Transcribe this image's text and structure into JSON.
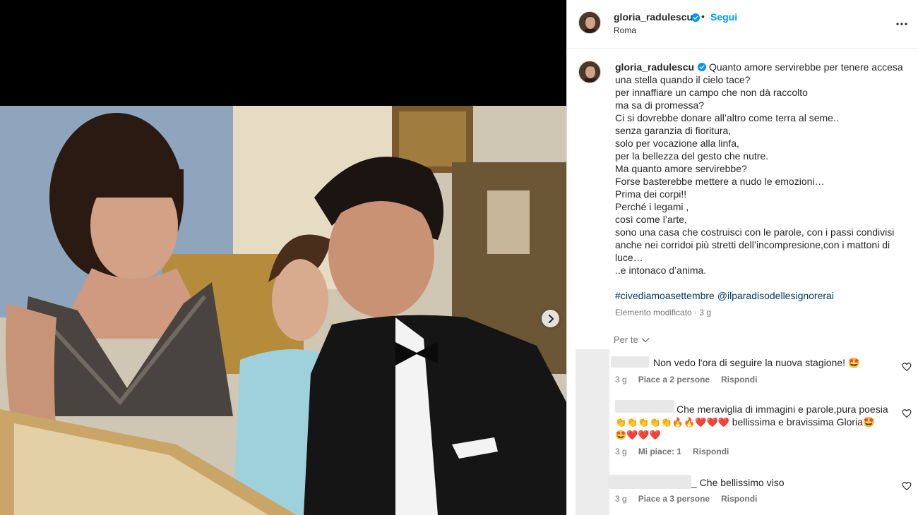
{
  "post": {
    "username": "gloria_radulescu",
    "follow_label": "Segui",
    "separator": "•",
    "location": "Roma"
  },
  "caption": {
    "username": "gloria_radulescu",
    "lines": [
      "Quanto amore servirebbe per tenere accesa",
      "una stella quando il cielo tace?",
      "per innaffiare un campo che non dà raccolto",
      "ma sa di promessa?",
      "Ci si dovrebbe donare all’altro come terra al seme..",
      "senza garanzia di fioritura,",
      "solo per vocazione alla linfa,",
      "per la bellezza del gesto che nutre.",
      "Ma quanto amore servirebbe?",
      "Forse basterebbe mettere a nudo le emozioni…",
      "Prima dei corpi!!",
      "Perché i legami ,",
      "così come l’arte,",
      "sono una casa che costruisci con le parole, con i passi condivisi",
      "anche nei corridoi più stretti dell’incompresione,con i mattoni di",
      "luce…",
      "..e intonaco d’anima."
    ],
    "hashtag_1": "#civediamoasettembre",
    "hashtag_2": "@ilparadisodellesignorerai",
    "edited": "Elemento modificato · 3 g"
  },
  "sort_label": "Per te",
  "comments": [
    {
      "text": "Non vedo l'ora di seguire la nuova stagione! 🤩",
      "time": "3 g",
      "likes": "Piace a 2 persone",
      "reply": "Rispondi"
    },
    {
      "text_line1": "Che meraviglia di immagini e parole,pura poesia",
      "emoji_line2": "👏👏👏👏👏🔥🔥❤️❤️❤️",
      "text_line2": " bellissima e bravissima Gloria🤩",
      "emoji_line3": "🤩❤️❤️❤️",
      "time": "3 g",
      "likes": "Mi piace: 1",
      "reply": "Rispondi"
    },
    {
      "text": "_ Che bellissimo viso",
      "time": "3 g",
      "likes": "Piace a 3 persone",
      "reply": "Rispondi"
    }
  ],
  "colors": {
    "link_blue": "#0095f6",
    "hashtag": "#00376b",
    "muted": "#737373",
    "verified": "#0095f6"
  },
  "icons": {
    "next": "chevron-right-icon",
    "more": "more-options-icon",
    "verified": "verified-badge-icon",
    "like": "heart-icon",
    "sort": "chevron-down-icon"
  }
}
